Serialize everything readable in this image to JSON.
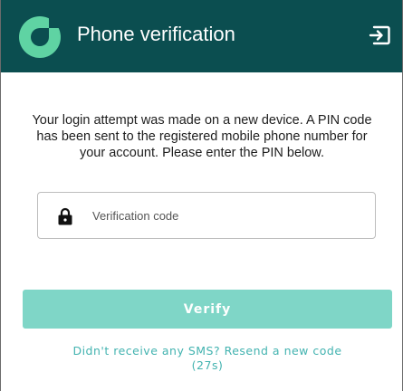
{
  "header": {
    "title": "Phone verification",
    "logo_icon": "logo-icon",
    "logout_icon": "logout-icon",
    "background_color": "#0b4e50"
  },
  "message": "Your login attempt was made on a new device. A PIN code has been sent to the registered mobile phone number for your account. Please enter the PIN below.",
  "verification_field": {
    "value": "",
    "placeholder": "Verification code",
    "icon": "lock-icon"
  },
  "verify_button": {
    "label": "Verify",
    "color": "#7fd6c7"
  },
  "resend": {
    "text": "Didn't receive any SMS? Resend a new code",
    "countdown": "(27s)",
    "color": "#43b3b0"
  }
}
